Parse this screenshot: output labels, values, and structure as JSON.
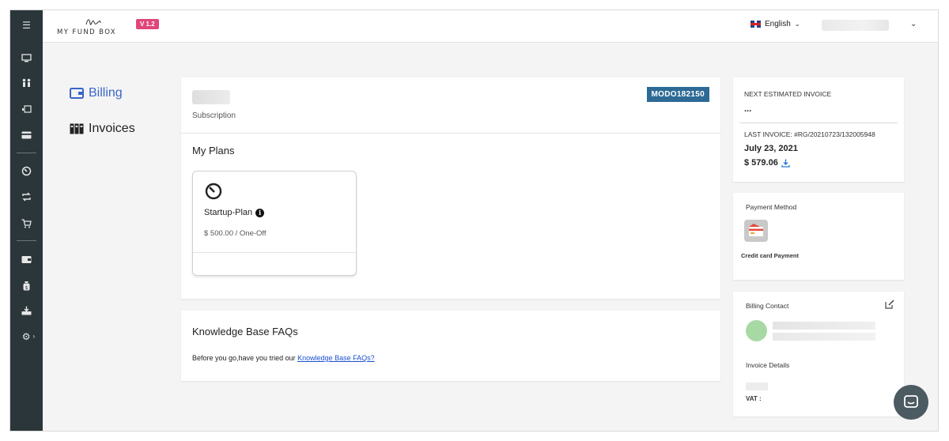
{
  "app": {
    "logo_text": "MY FUND BOX",
    "version": "V 1.2"
  },
  "topbar": {
    "language": "English"
  },
  "nav": {
    "billing": "Billing",
    "invoices": "Invoices"
  },
  "subscription": {
    "label": "Subscription",
    "code": "MODO182150"
  },
  "plans": {
    "heading": "My Plans",
    "items": [
      {
        "name": "Startup-Plan",
        "price": "$ 500.00 / One-Off"
      }
    ]
  },
  "kb": {
    "heading": "Knowledge Base FAQs",
    "prompt": "Before you go,have you tried our ",
    "link": "Knowledge Base FAQs?"
  },
  "invoice": {
    "next_heading": "NEXT ESTIMATED INVOICE",
    "next_value": "...",
    "last_heading": "LAST INVOICE: #RG/20210723/132005948",
    "last_date": "July 23, 2021",
    "last_amount": "$ 579.06"
  },
  "payment": {
    "heading": "Payment Method",
    "label": "Credit card Payment"
  },
  "contact": {
    "heading": "Billing Contact",
    "invoice_details": "Invoice Details",
    "vat": "VAT :"
  },
  "colors": {
    "accent": "#3b64c9",
    "badge": "#2e6a96",
    "version": "#e0467a",
    "rail": "#2a363a"
  }
}
